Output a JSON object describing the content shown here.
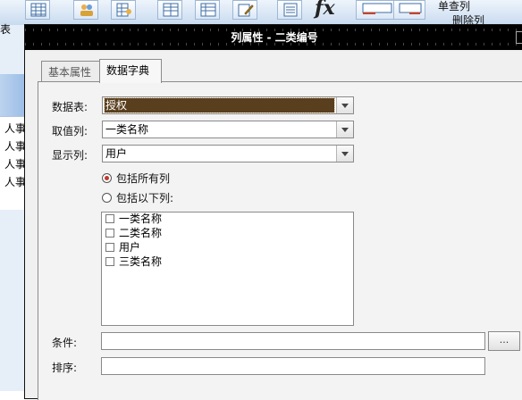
{
  "background_app": {
    "toolbar": {
      "icons": [
        "table-grid-icon",
        "users-icon",
        "table-user-icon",
        "grid-icon",
        "grid-icon",
        "edit-icon",
        "list-icon",
        "function-icon",
        "grid-left-icon",
        "grid-right-icon"
      ],
      "fx_label": "fx",
      "right_item_1": "单查列",
      "right_item_2": "删除列"
    },
    "left_partial_label": "表",
    "left_rows": [
      "人事",
      "人事",
      "人事",
      "人事"
    ]
  },
  "dialog": {
    "title": "列属性 - 二类编号",
    "tabs": [
      {
        "label": "基本属性",
        "active": false
      },
      {
        "label": "数据字典",
        "active": true
      }
    ],
    "fields": {
      "table": {
        "label": "数据表:",
        "value": "授权"
      },
      "value_column": {
        "label": "取值列:",
        "value": "一类名称"
      },
      "display_column": {
        "label": "显示列:",
        "value": "用户"
      }
    },
    "radio_all": {
      "label": "包括所有列",
      "checked": true
    },
    "radio_following": {
      "label": "包括以下列:",
      "checked": false
    },
    "column_list": [
      {
        "label": "一类名称",
        "checked": false
      },
      {
        "label": "二类名称",
        "checked": false
      },
      {
        "label": "用户",
        "checked": false
      },
      {
        "label": "三类名称",
        "checked": false
      }
    ],
    "condition": {
      "label": "条件:",
      "value": "",
      "browse_label": "..."
    },
    "sort": {
      "label": "排序:",
      "value": ""
    }
  },
  "colors": {
    "title_bar": "#000000",
    "selection": "#5a3f1e",
    "radio_dot": "#c0392b"
  }
}
